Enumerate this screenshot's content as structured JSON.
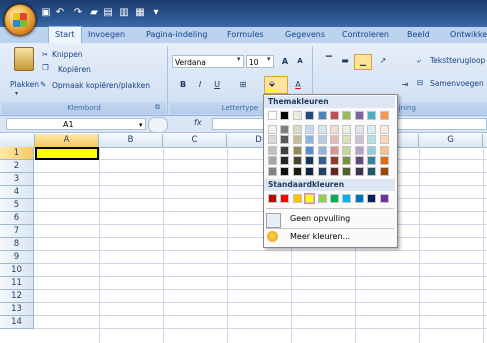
{
  "tabs": [
    "Start",
    "Invoegen",
    "Pagina-indeling",
    "Formules",
    "Gegevens",
    "Controleren",
    "Beeld",
    "Ontwikke"
  ],
  "active_tab": "Start",
  "ribbon": {
    "clipboard": {
      "paste": "Plakken",
      "cut": "Knippen",
      "copy": "Kopiëren",
      "format_painter": "Opmaak kopiëren/plakken",
      "group_label": "Klembord"
    },
    "font": {
      "font_name": "Verdana",
      "font_size": "10",
      "group_label": "Lettertype"
    },
    "alignment": {
      "wrap_text": "Tekstterugloop",
      "merge": "Samenvoegen",
      "group_label": "Uitlijning"
    }
  },
  "formula_bar": {
    "name_box": "A1",
    "fx": "fx"
  },
  "columns": [
    "A",
    "B",
    "C",
    "D",
    "",
    "",
    "G"
  ],
  "rows": [
    "1",
    "2",
    "3",
    "4",
    "5",
    "6",
    "7",
    "8",
    "9",
    "10",
    "11",
    "12",
    "13",
    "14"
  ],
  "selected_cell": "A1",
  "selected_cell_fill": "#ffff00",
  "palette": {
    "theme_header": "Themakleuren",
    "standard_header": "Standaardkleuren",
    "no_fill": "Geen opvulling",
    "more_colors": "Meer kleuren...",
    "theme_colors": [
      [
        "#ffffff",
        "#f2f2f2",
        "#d9d9d9",
        "#bfbfbf",
        "#a6a6a6",
        "#808080"
      ],
      [
        "#000000",
        "#7f7f7f",
        "#595959",
        "#404040",
        "#262626",
        "#0d0d0d"
      ],
      [
        "#eeece1",
        "#ddd9c3",
        "#c4bd97",
        "#948a54",
        "#4a452a",
        "#1d1b10"
      ],
      [
        "#1f497d",
        "#c6d9f0",
        "#8db3e2",
        "#548dd4",
        "#17365d",
        "#0f243e"
      ],
      [
        "#4f81bd",
        "#dbe5f1",
        "#b8cce4",
        "#95b3d7",
        "#366092",
        "#244061"
      ],
      [
        "#c0504d",
        "#f2dcdb",
        "#e5b9b7",
        "#d99694",
        "#953734",
        "#632423"
      ],
      [
        "#9bbb59",
        "#ebf1dd",
        "#d7e3bc",
        "#c3d69b",
        "#76923c",
        "#4f6128"
      ],
      [
        "#8064a2",
        "#e5e0ec",
        "#ccc1d9",
        "#b2a2c7",
        "#5f497a",
        "#3f3151"
      ],
      [
        "#4bacc6",
        "#dbeef3",
        "#b7dde8",
        "#92cddc",
        "#31859b",
        "#205867"
      ],
      [
        "#f79646",
        "#fdeada",
        "#fbd5b5",
        "#fac08f",
        "#e36c09",
        "#974806"
      ]
    ],
    "standard_colors": [
      "#c00000",
      "#ff0000",
      "#ffc000",
      "#ffff00",
      "#92d050",
      "#00b050",
      "#00b0f0",
      "#0070c0",
      "#002060",
      "#7030a0"
    ]
  }
}
